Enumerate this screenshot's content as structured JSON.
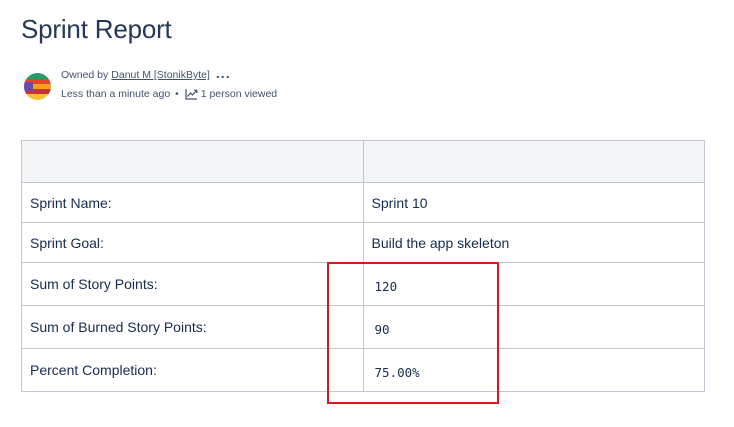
{
  "page": {
    "title": "Sprint Report"
  },
  "byline": {
    "owned_by_label": "Owned by",
    "owner_name": "Danut M [StonikByte]",
    "more_label": "...",
    "updated": "Less than a minute ago",
    "separator": "•",
    "viewers": "1 person viewed",
    "icons": {
      "avatar": "avatar-icon",
      "analytics": "analytics-chart-icon"
    }
  },
  "table": {
    "header": [
      "",
      ""
    ],
    "rows": [
      {
        "label": "Sprint Name:",
        "value": "Sprint 10"
      },
      {
        "label": "Sprint Goal:",
        "value": "Build the app skeleton"
      },
      {
        "label": "Sum of Story Points:",
        "value": "120"
      },
      {
        "label": "Sum of Burned Story Points:",
        "value": "90"
      },
      {
        "label": "Percent Completion:",
        "value": "75.00%"
      }
    ]
  },
  "colors": {
    "highlight": "#e0141e",
    "header_bg": "#f4f5f7",
    "border": "#c1c7d0"
  }
}
